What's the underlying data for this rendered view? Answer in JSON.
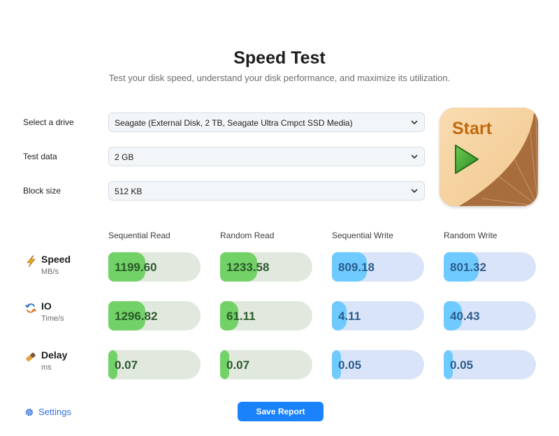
{
  "header": {
    "title": "Speed Test",
    "subtitle": "Test your disk speed, understand your disk performance, and maximize its utilization."
  },
  "form": {
    "drive": {
      "label": "Select a drive",
      "value": "Seagate (External Disk, 2 TB, Seagate Ultra Cmpct SSD Media)"
    },
    "test_data": {
      "label": "Test data",
      "value": "2 GB"
    },
    "block_size": {
      "label": "Block size",
      "value": "512 KB"
    }
  },
  "start_button": {
    "label": "Start",
    "icon": "play-icon"
  },
  "columns": [
    "Sequential Read",
    "Random Read",
    "Sequential Write",
    "Random Write"
  ],
  "metrics": [
    {
      "name": "Speed",
      "unit": "MB/s",
      "icon": "lightning-icon",
      "values": [
        "1199.60",
        "1233.58",
        "809.18",
        "801.32"
      ],
      "fill_fraction": [
        0.4,
        0.4,
        0.38,
        0.38
      ]
    },
    {
      "name": "IO",
      "unit": "Time/s",
      "icon": "exchange-arrows-icon",
      "values": [
        "1296.82",
        "61.11",
        "4.11",
        "40.43"
      ],
      "fill_fraction": [
        0.4,
        0.2,
        0.16,
        0.2
      ]
    },
    {
      "name": "Delay",
      "unit": "ms",
      "icon": "eraser-icon",
      "values": [
        "0.07",
        "0.07",
        "0.05",
        "0.05"
      ],
      "fill_fraction": [
        0.1,
        0.1,
        0.1,
        0.1
      ]
    }
  ],
  "footer": {
    "settings_label": "Settings",
    "save_label": "Save Report"
  },
  "colors": {
    "accent": "#1a82fb",
    "read_fill": "#72d167",
    "read_track": "#e1e9de",
    "write_fill": "#6fcbff",
    "write_track": "#dae4f8",
    "start_orange": "#c06a10"
  }
}
